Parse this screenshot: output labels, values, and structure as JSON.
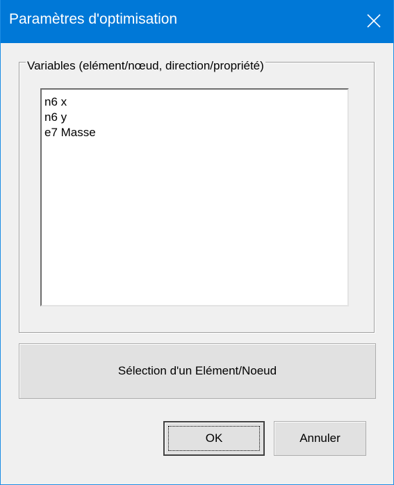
{
  "window": {
    "title": "Paramètres d'optimisation"
  },
  "icons": {
    "close": "close-icon"
  },
  "variables_group": {
    "legend": "Variables (elément/nœud, direction/propriété)",
    "items": [
      {
        "label": "n6 x"
      },
      {
        "label": "n6 y"
      },
      {
        "label": "e7 Masse"
      }
    ]
  },
  "buttons": {
    "select_label": "Sélection d'un Elément/Noeud",
    "ok_label": "OK",
    "cancel_label": "Annuler"
  },
  "colors": {
    "titlebar": "#0078d7",
    "window_bg": "#f0f0f0",
    "button_bg": "#e1e1e1"
  }
}
